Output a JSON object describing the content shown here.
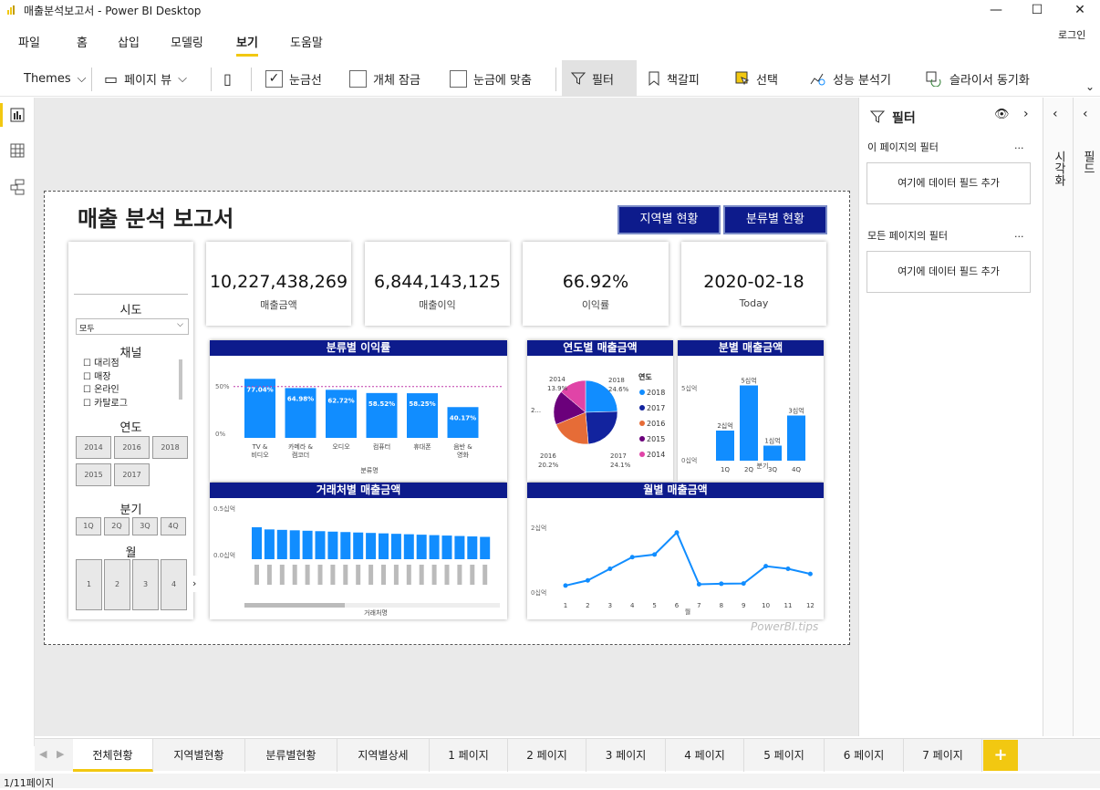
{
  "window": {
    "title": "매출분석보고서 - Power BI Desktop",
    "login": "로그인"
  },
  "menu": [
    "파일",
    "홈",
    "삽입",
    "모델링",
    "보기",
    "도움말"
  ],
  "menu_active": "보기",
  "ribbon": {
    "themes": "Themes",
    "page_view": "페이지 뷰",
    "gridlines": "눈금선",
    "lock_objects": "개체 잠금",
    "snap": "눈금에 맞춤",
    "filter": "필터",
    "bookmark": "책갈피",
    "selection": "선택",
    "perf": "성능 분석기",
    "sync": "슬라이서 동기화"
  },
  "report": {
    "title": "매출 분석 보고서",
    "nav_buttons": [
      "지역별 현황",
      "분류별 현황"
    ],
    "kpis": [
      {
        "value": "10,227,438,269",
        "label": "매출금액"
      },
      {
        "value": "6,844,143,125",
        "label": "매출이익"
      },
      {
        "value": "66.92%",
        "label": "이익률"
      },
      {
        "value": "2020-02-18",
        "label": "Today"
      }
    ],
    "slicer": {
      "sido_label": "시도",
      "sido_value": "모두",
      "channel_label": "채널",
      "channels": [
        "대리점",
        "매장",
        "온라인",
        "카탈로그"
      ],
      "year_label": "연도",
      "years": [
        "2014",
        "2016",
        "2018",
        "2015",
        "2017"
      ],
      "quarter_label": "분기",
      "quarters": [
        "1Q",
        "2Q",
        "3Q",
        "4Q"
      ],
      "month_label": "월",
      "months": [
        "1",
        "2",
        "3",
        "4"
      ]
    },
    "watermark": "PowerBI.tips"
  },
  "chart_data": [
    {
      "type": "bar",
      "title": "분류별 이익률",
      "xlabel": "분류명",
      "categories": [
        "TV & 비디오",
        "카메라 & 캠코더",
        "오디오",
        "컴퓨터",
        "휴대폰",
        "음반 & 영화"
      ],
      "values": [
        77.04,
        64.98,
        62.72,
        58.52,
        58.25,
        40.17
      ],
      "data_labels": [
        "77.04%",
        "64.98%",
        "62.72%",
        "58.52%",
        "58.25%",
        "40.17%"
      ],
      "y_ticks": [
        "50%",
        "0%"
      ],
      "reference_line": 66.92
    },
    {
      "type": "pie",
      "title": "연도별 매출금액",
      "legend_title": "연도",
      "slices": [
        {
          "name": "2018",
          "value": 24.6,
          "color": "#118dff"
        },
        {
          "name": "2017",
          "value": 24.1,
          "color": "#12239e"
        },
        {
          "name": "2016",
          "value": 20.2,
          "color": "#e66c37"
        },
        {
          "name": "2015",
          "value": 17.4,
          "color": "#6b007b"
        },
        {
          "name": "2014",
          "value": 13.9,
          "color": "#e044a7"
        }
      ],
      "labels": [
        "2018",
        "24.6%",
        "2017",
        "24.1%",
        "2016",
        "20.2%",
        "2014",
        "13.9%",
        "2..."
      ]
    },
    {
      "type": "bar",
      "title": "분별 매출금액",
      "xlabel": "분기",
      "categories": [
        "1Q",
        "2Q",
        "3Q",
        "4Q"
      ],
      "values": [
        2,
        5,
        1,
        3
      ],
      "data_labels": [
        "2십억",
        "5십억",
        "1십억",
        "3십억"
      ],
      "y_ticks": [
        "5십억",
        "0십억"
      ]
    },
    {
      "type": "bar",
      "title": "거래처별 매출금액",
      "xlabel": "거래처명",
      "values": [
        0.73,
        0.68,
        0.67,
        0.66,
        0.65,
        0.64,
        0.63,
        0.62,
        0.61,
        0.6,
        0.59,
        0.58,
        0.57,
        0.56,
        0.55,
        0.54,
        0.53,
        0.52,
        0.51
      ],
      "y_ticks": [
        "0.5십억",
        "0.0십억"
      ]
    },
    {
      "type": "line",
      "title": "월별 매출금액",
      "xlabel": "월",
      "x": [
        1,
        2,
        3,
        4,
        5,
        6,
        7,
        8,
        9,
        10,
        11,
        12
      ],
      "values": [
        0.25,
        0.45,
        0.9,
        1.35,
        1.45,
        2.3,
        0.3,
        0.32,
        0.33,
        1.0,
        0.9,
        0.7
      ],
      "y_ticks": [
        "2십억",
        "0십억"
      ]
    }
  ],
  "filter_pane": {
    "title": "필터",
    "this_page": "이 페이지의 필터",
    "all_pages": "모든 페이지의 필터",
    "add_field": "여기에 데이터 필드 추가",
    "more": "..."
  },
  "side_panes": {
    "visual": "시각화",
    "fields": "필드"
  },
  "tabs": [
    "전체현황",
    "지역별현황",
    "분류별현황",
    "지역별상세",
    "1 페이지",
    "2 페이지",
    "3 페이지",
    "4 페이지",
    "5 페이지",
    "6 페이지",
    "7 페이지"
  ],
  "status": "1/11페이지"
}
